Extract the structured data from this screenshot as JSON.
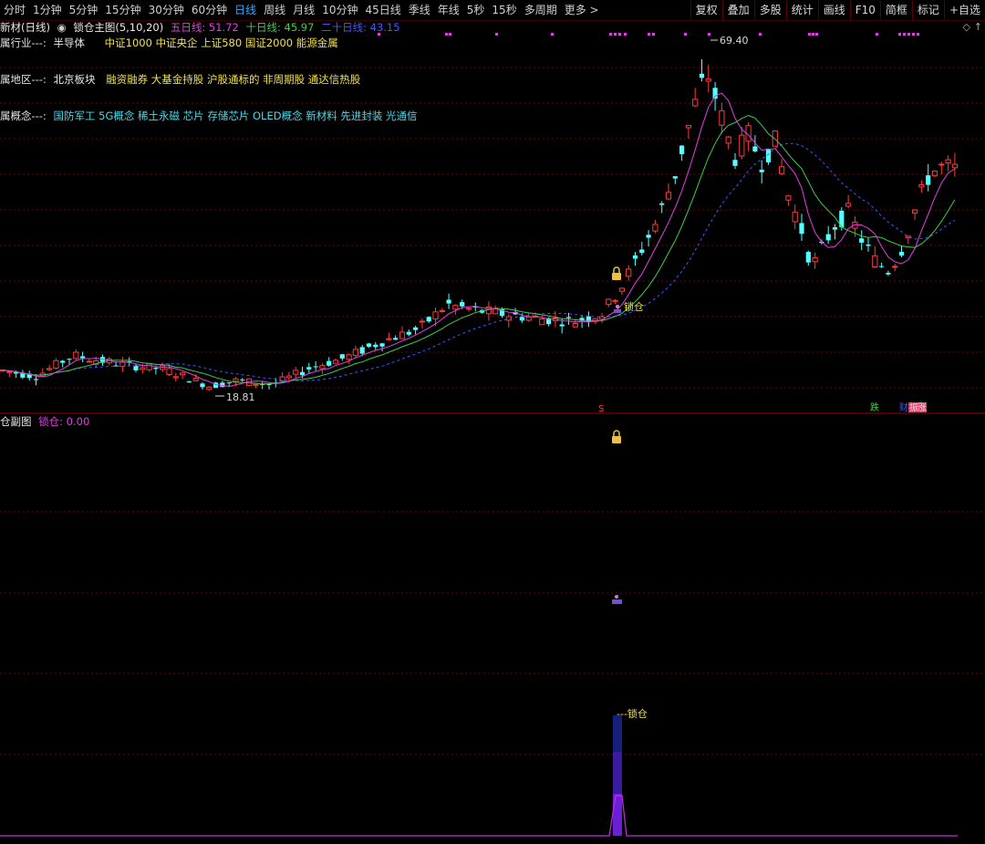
{
  "toolbar": {
    "periods": [
      "分时",
      "1分钟",
      "5分钟",
      "15分钟",
      "30分钟",
      "60分钟",
      "日线",
      "周线",
      "月线",
      "10分钟",
      "45日线",
      "季线",
      "年线",
      "5秒",
      "15秒",
      "多周期",
      "更多 >"
    ],
    "active_period": "日线",
    "tools": [
      "复权",
      "叠加",
      "多股",
      "统计",
      "画线",
      "F10",
      "简框",
      "标记",
      "+自选"
    ]
  },
  "main_chart": {
    "title": "新材(日线)",
    "indicator_name": "锁仓主图(5,10,20)",
    "ma5_label": "五日线: 51.72",
    "ma10_label": "十日线: 45.97",
    "ma20_label": "二十日线: 43.15",
    "industry_label": "属行业---:",
    "industry_value": "半导体",
    "indices": "中证1000 中证央企 上证580 国证2000 能源金属",
    "region_label": "属地区---:",
    "region_value": "北京板块",
    "region_tags": "融资融券 大基金持股 沪股通标的 非周期股 通达信热股",
    "concept_label": "属概念---:",
    "concept_value": "国防军工 5G概念 稀土永磁 芯片 存储芯片 OLED概念 新材料 先进封装 光通信",
    "high_price": "69.40",
    "low_price": "18.81",
    "lock_label": "锁仓",
    "bottom_markers": [
      "S",
      "跌",
      "财",
      "振",
      "涨"
    ]
  },
  "sub_chart": {
    "title": "仓副图",
    "value_label": "锁仓: 0.00",
    "lock_label": "---锁仓"
  },
  "colors": {
    "up": "#ff3b3b",
    "down": "#54ffff",
    "ma5": "#e040e0",
    "ma10": "#39d04a",
    "ma20": "#3a5bff",
    "grid": "#7a0000",
    "lock_bar": "#6b1fd6"
  },
  "chart_data": {
    "type": "candlestick",
    "series": [
      {
        "name": "五日线",
        "values": [
          51.72
        ]
      },
      {
        "name": "十日线",
        "values": [
          45.97
        ]
      },
      {
        "name": "二十日线",
        "values": [
          43.15
        ]
      }
    ],
    "high": 69.4,
    "low": 18.81
  }
}
